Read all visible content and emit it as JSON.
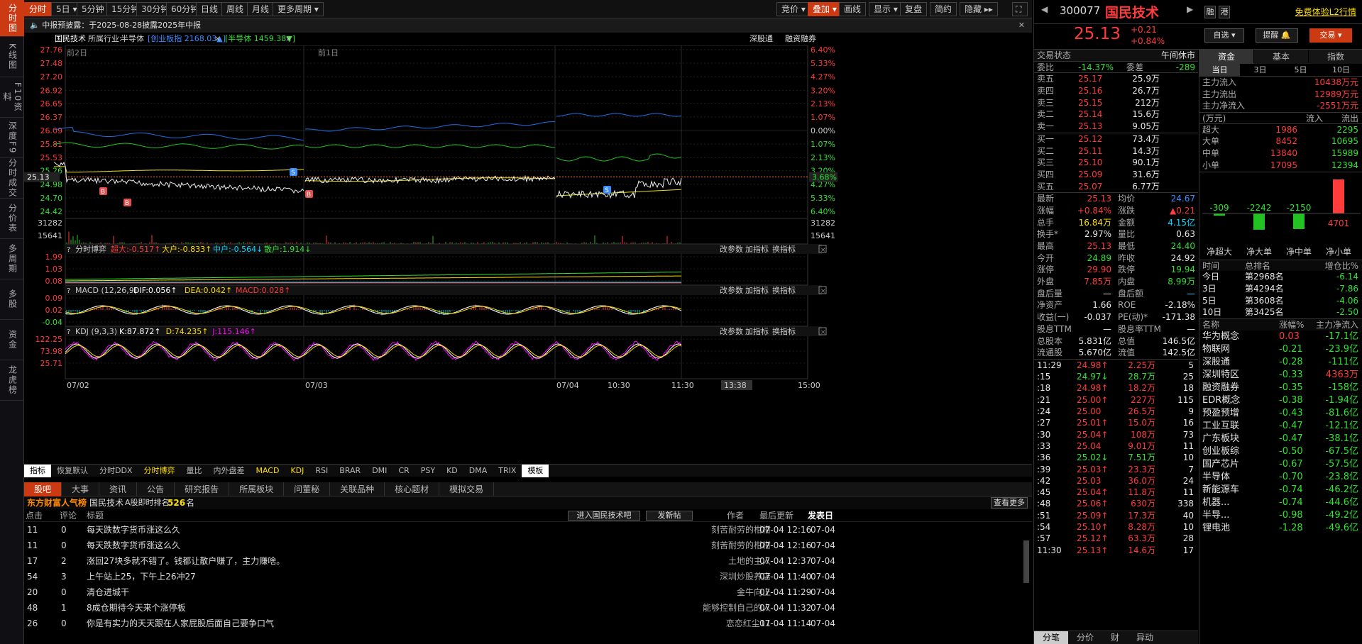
{
  "left_nav": [
    "分时图",
    "K线图",
    "F10资料",
    "深度F9",
    "分时成交",
    "分价表",
    "多周期",
    "多股",
    "资金",
    "龙虎榜"
  ],
  "toolbar": {
    "left": [
      "分时",
      "5日",
      "5分钟",
      "15分钟",
      "30分钟",
      "60分钟",
      "日线",
      "周线",
      "月线",
      "更多周期"
    ],
    "right": [
      "竞价",
      "叠加",
      "画线",
      "显示",
      "复盘",
      "简约",
      "隐藏"
    ]
  },
  "notice": "中报预披露：于2025-08-28披露2025年中报",
  "info": {
    "name": "国民技术",
    "industry_label": "所属行业:",
    "industry": "半导体",
    "idx1": "[创业板指 2168.03▲]",
    "idx2": "[半导体 1459.38▼]",
    "r1": "深股通",
    "r2": "融资融券"
  },
  "chart": {
    "y_left": [
      "27.76",
      "27.48",
      "27.20",
      "26.92",
      "26.65",
      "26.37",
      "26.09",
      "25.81",
      "25.53",
      "25.26",
      "24.98",
      "24.70",
      "24.42"
    ],
    "y_right": [
      "6.40%",
      "5.33%",
      "4.27%",
      "3.20%",
      "2.13%",
      "1.07%",
      "0.00%",
      "1.07%",
      "2.13%",
      "3.20%",
      "4.27%",
      "5.33%",
      "6.40%"
    ],
    "cur_price": "25.13",
    "cur_pct": "3.68%",
    "day_labels": [
      "前2日",
      "前1日"
    ],
    "vol_left": [
      "31282",
      "15641"
    ],
    "vol_right": [
      "31282",
      "15641"
    ],
    "x_labels": [
      "07/02",
      "07/03",
      "07/04",
      "10:30",
      "11:30",
      "13:38",
      "15:00"
    ],
    "markers": [
      "B",
      "B",
      "S",
      "B",
      "S"
    ]
  },
  "indicators": {
    "i1": {
      "name": "分时博弈",
      "vals": [
        "超大:-0.517↑",
        "大户:-0.833↑",
        "中户:-0.564↓",
        "散户:1.914↓"
      ],
      "y": [
        "1.99",
        "1.03",
        "0.08"
      ]
    },
    "i2": {
      "name": "MACD (12,26,9)",
      "vals": [
        "DIF:0.056↑",
        "DEA:0.042↑",
        "MACD:0.028↑"
      ],
      "y": [
        "0.09",
        "0.02",
        "-0.04"
      ]
    },
    "i3": {
      "name": "KDJ (9,3,3)",
      "vals": [
        "K:87.872↑",
        "D:74.235↑",
        "J:115.146↑"
      ],
      "y": [
        "122.25",
        "73.98",
        "25.71"
      ]
    },
    "actions": [
      "改参数",
      "加指标",
      "换指标"
    ]
  },
  "bottom_tabs": [
    "指标",
    "恢复默认",
    "分时DDX",
    "分时博弈",
    "量比",
    "内外盘差",
    "MACD",
    "KDJ",
    "RSI",
    "BRAR",
    "DMI",
    "CR",
    "PSY",
    "KD",
    "DMA",
    "TRIX",
    "模板"
  ],
  "forum": {
    "tabs": [
      "股吧",
      "大事",
      "资讯",
      "公告",
      "研究报告",
      "所属板块",
      "问董秘",
      "关联品种",
      "核心题材",
      "模拟交易"
    ],
    "brand": "东方财富人气榜",
    "stock": "国民技术",
    "rank_label": "A股即时排名",
    "rank": "526",
    "rank_unit": "名",
    "more": "查看更多",
    "headers": [
      "点击",
      "评论",
      "标题",
      "作者",
      "最后更新",
      "发表日"
    ],
    "enter": "进入国民技术吧",
    "post": "发新帖",
    "rows": [
      [
        "11",
        "0",
        "每天跌数字货币涨这么久",
        "刻苦耐劳的柑柑",
        "07-04 12:16",
        "07-04"
      ],
      [
        "11",
        "0",
        "每天跌数字货币涨这么久",
        "刻苦耐劳的柑柑",
        "07-04 12:16",
        "07-04"
      ],
      [
        "17",
        "2",
        "涨回27块多就不错了。钱都让散户赚了，主力赚啥。",
        "土地的主人",
        "07-04 12:37",
        "07-04"
      ],
      [
        "54",
        "3",
        "上午站上25，下午上26冲27",
        "深圳炒股养店",
        "07-04 11:40",
        "07-04"
      ],
      [
        "20",
        "0",
        "清仓进城干",
        "金牛向上",
        "07-04 11:29",
        "07-04"
      ],
      [
        "48",
        "1",
        "8成仓期待今天来个涨停板",
        "能够控制自己的人",
        "07-04 11:32",
        "07-04"
      ],
      [
        "26",
        "0",
        "你是有实力的天天跟在人家屁股后面自己要争口气",
        "恋恋红尘11",
        "07-04 11:14",
        "07-04"
      ]
    ]
  },
  "quote": {
    "code": "300077",
    "name": "国民技术",
    "price": "25.13",
    "chg": "+0.21",
    "pct": "+0.84%",
    "b1": "融",
    "b2": "港",
    "l2": "免费体验L2行情",
    "self": "自选",
    "remind": "提醒",
    "trade": "交易",
    "status_label": "交易状态",
    "status": "午间休市",
    "wb_label": "委比",
    "wb": "-14.37%",
    "wc_label": "委差",
    "wc": "-289",
    "asks": [
      [
        "卖五",
        "25.17",
        "25.9万"
      ],
      [
        "卖四",
        "25.16",
        "26.7万"
      ],
      [
        "卖三",
        "25.15",
        "212万"
      ],
      [
        "卖二",
        "25.14",
        "15.6万"
      ],
      [
        "卖一",
        "25.13",
        "9.05万"
      ]
    ],
    "bids": [
      [
        "买一",
        "25.12",
        "73.4万"
      ],
      [
        "买二",
        "25.11",
        "14.3万"
      ],
      [
        "买三",
        "25.10",
        "90.1万"
      ],
      [
        "买四",
        "25.09",
        "31.6万"
      ],
      [
        "买五",
        "25.07",
        "6.77万"
      ]
    ],
    "stats": [
      [
        "最新",
        "25.13",
        "均价",
        "24.67"
      ],
      [
        "涨幅",
        "+0.84%",
        "涨跌",
        "▲0.21"
      ],
      [
        "总手",
        "16.84万",
        "金额",
        "4.15亿"
      ],
      [
        "换手*",
        "2.97%",
        "量比",
        "0.63"
      ],
      [
        "最高",
        "25.13",
        "最低",
        "24.40"
      ],
      [
        "今开",
        "24.89",
        "昨收",
        "24.92"
      ],
      [
        "涨停",
        "29.90",
        "跌停",
        "19.94"
      ],
      [
        "外盘",
        "7.85万",
        "内盘",
        "8.99万"
      ],
      [
        "盘后量",
        "—",
        "盘后额",
        "—"
      ],
      [
        "净资产",
        "1.66",
        "ROE",
        "-2.18%"
      ],
      [
        "收益(一)",
        "-0.037",
        "PE(动)*",
        "-171.38"
      ],
      [
        "股息TTM",
        "—",
        "股息率TTM",
        "—"
      ],
      [
        "总股本",
        "5.831亿",
        "总值",
        "146.5亿"
      ],
      [
        "流通股",
        "5.670亿",
        "流值",
        "142.5亿"
      ]
    ],
    "ticks": [
      [
        "11:29",
        "24.98↑",
        "2.25万",
        "5"
      ],
      [
        ":15",
        "24.97↓",
        "28.7万",
        "25"
      ],
      [
        ":18",
        "24.98↑",
        "18.2万",
        "18"
      ],
      [
        ":21",
        "25.00↑",
        "227万",
        "115"
      ],
      [
        ":24",
        "25.00",
        "26.5万",
        "9"
      ],
      [
        ":27",
        "25.01↑",
        "15.0万",
        "16"
      ],
      [
        ":30",
        "25.04↑",
        "108万",
        "73"
      ],
      [
        ":33",
        "25.04",
        "9.01万",
        "11"
      ],
      [
        ":36",
        "25.02↓",
        "7.51万",
        "10"
      ],
      [
        ":39",
        "25.03↑",
        "23.3万",
        "7"
      ],
      [
        ":42",
        "25.03",
        "36.0万",
        "24"
      ],
      [
        ":45",
        "25.04↑",
        "11.8万",
        "11"
      ],
      [
        ":48",
        "25.06↑",
        "630万",
        "338"
      ],
      [
        ":51",
        "25.09↑",
        "17.3万",
        "40"
      ],
      [
        ":54",
        "25.10↑",
        "8.28万",
        "10"
      ],
      [
        ":57",
        "25.12↑",
        "63.3万",
        "28"
      ],
      [
        "11:30",
        "25.13↑",
        "14.6万",
        "17"
      ]
    ],
    "tick_tabs": [
      "分笔",
      "分价",
      "财",
      "异动"
    ]
  },
  "fund": {
    "tabs": [
      "资金",
      "基本",
      "指数"
    ],
    "periods": [
      "当日",
      "3日",
      "5日",
      "10日"
    ],
    "flows": [
      [
        "主力流入",
        "10438万元"
      ],
      [
        "主力流出",
        "12989万元"
      ],
      [
        "主力净流入",
        "-2551万元"
      ]
    ],
    "unit": "(万元)",
    "in": "流入",
    "out": "流出",
    "tbl": [
      [
        "超大",
        "1986",
        "2295"
      ],
      [
        "大单",
        "8452",
        "10695"
      ],
      [
        "中单",
        "13840",
        "15989"
      ],
      [
        "小单",
        "17095",
        "12394"
      ]
    ],
    "bars": [
      "-309",
      "-2242",
      "-2150",
      "4701"
    ],
    "bar_labels": [
      "净超大",
      "净大单",
      "净中单",
      "净小单"
    ],
    "rank_hdr": [
      "时间",
      "总排名",
      "增仓比%"
    ],
    "ranks": [
      [
        "今日",
        "第2968名",
        "-6.14"
      ],
      [
        "3日",
        "第4294名",
        "-7.86"
      ],
      [
        "5日",
        "第3608名",
        "-4.06"
      ],
      [
        "10日",
        "第3425名",
        "-2.50"
      ]
    ],
    "sect_hdr": [
      "名称",
      "涨幅%",
      "主力净流入"
    ],
    "sectors": [
      [
        "华为概念",
        "0.03",
        "-17.1亿"
      ],
      [
        "物联网",
        "-0.21",
        "-23.9亿"
      ],
      [
        "深股通",
        "-0.28",
        "-111亿"
      ],
      [
        "深圳特区",
        "-0.33",
        "4363万"
      ],
      [
        "融资融券",
        "-0.35",
        "-158亿"
      ],
      [
        "EDR概念",
        "-0.38",
        "-1.94亿"
      ],
      [
        "预盈预增",
        "-0.43",
        "-81.6亿"
      ],
      [
        "工业互联",
        "-0.47",
        "-12.1亿"
      ],
      [
        "广东板块",
        "-0.47",
        "-38.1亿"
      ],
      [
        "创业板综",
        "-0.50",
        "-67.5亿"
      ],
      [
        "国产芯片",
        "-0.67",
        "-57.5亿"
      ],
      [
        "半导体",
        "-0.70",
        "-23.8亿"
      ],
      [
        "新能源车",
        "-0.74",
        "-46.2亿"
      ],
      [
        "机器...",
        "-0.74",
        "-44.6亿"
      ],
      [
        "半导...",
        "-0.98",
        "-49.2亿"
      ],
      [
        "锂电池",
        "-1.28",
        "-49.6亿"
      ]
    ]
  }
}
